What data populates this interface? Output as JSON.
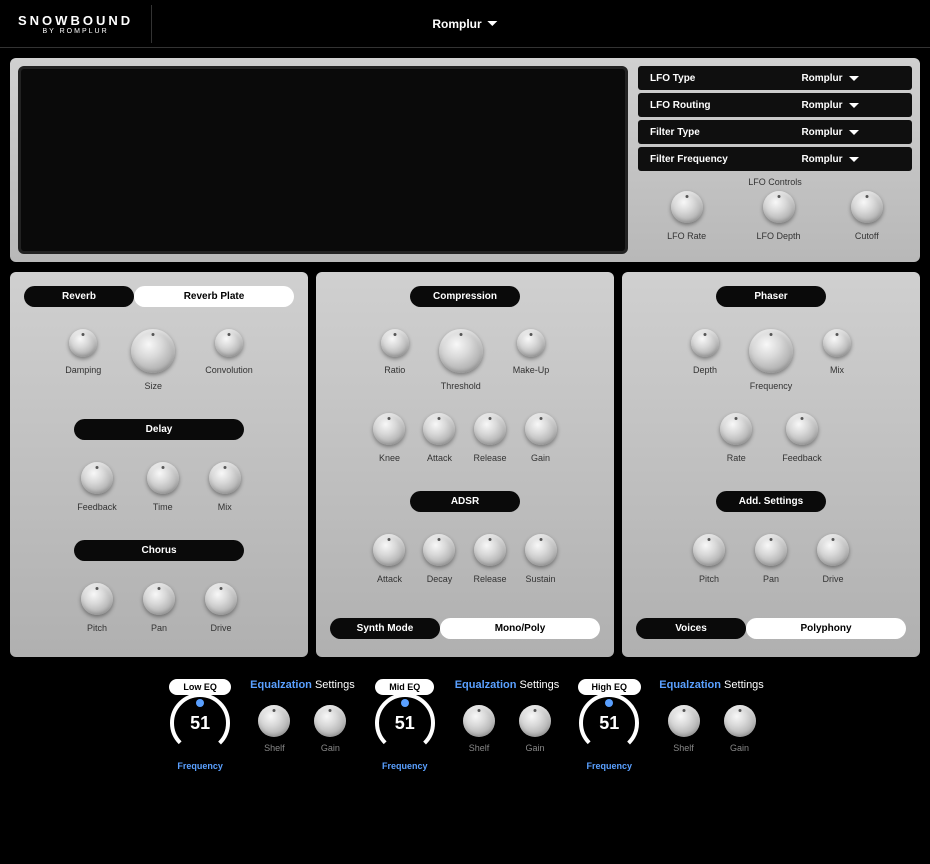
{
  "header": {
    "logo_main": "SNOWBOUND",
    "logo_sub": "BY ROMPLUR",
    "preset": "Romplur"
  },
  "lfo": {
    "rows": [
      {
        "label": "LFO Type",
        "value": "Romplur"
      },
      {
        "label": "LFO Routing",
        "value": "Romplur"
      },
      {
        "label": "Filter Type",
        "value": "Romplur"
      },
      {
        "label": "Filter Frequency",
        "value": "Romplur"
      }
    ],
    "controls_label": "LFO Controls",
    "knobs": [
      "LFO Rate",
      "LFO Depth",
      "Cutoff"
    ]
  },
  "panel1": {
    "reverb": {
      "tab1": "Reverb",
      "tab2": "Reverb Plate",
      "knobs": [
        "Damping",
        "Size",
        "Convolution"
      ]
    },
    "delay": {
      "title": "Delay",
      "knobs": [
        "Feedback",
        "Time",
        "Mix"
      ]
    },
    "chorus": {
      "title": "Chorus",
      "knobs": [
        "Pitch",
        "Pan",
        "Drive"
      ]
    }
  },
  "panel2": {
    "compression": {
      "title": "Compression",
      "knobs1": [
        "Ratio",
        "Threshold",
        "Make-Up"
      ],
      "knobs2": [
        "Knee",
        "Attack",
        "Release",
        "Gain"
      ]
    },
    "adsr": {
      "title": "ADSR",
      "knobs": [
        "Attack",
        "Decay",
        "Release",
        "Sustain"
      ]
    },
    "bottom": {
      "tab1": "Synth Mode",
      "tab2": "Mono/Poly"
    }
  },
  "panel3": {
    "phaser": {
      "title": "Phaser",
      "knobs1": [
        "Depth",
        "Frequency",
        "Mix"
      ],
      "knobs2": [
        "Rate",
        "Feedback"
      ]
    },
    "add": {
      "title": "Add. Settings",
      "knobs": [
        "Pitch",
        "Pan",
        "Drive"
      ]
    },
    "bottom": {
      "tab1": "Voices",
      "tab2": "Polyphony"
    }
  },
  "eq": {
    "bands": [
      {
        "badge": "Low EQ",
        "value": "51",
        "label": "Frequency"
      },
      {
        "badge": "Mid EQ",
        "value": "51",
        "label": "Frequency"
      },
      {
        "badge": "High EQ",
        "value": "51",
        "label": "Frequency"
      }
    ],
    "settings_title_accent": "Equalzation",
    "settings_title_rest": " Settings",
    "knobs": [
      "Shelf",
      "Gain"
    ]
  }
}
